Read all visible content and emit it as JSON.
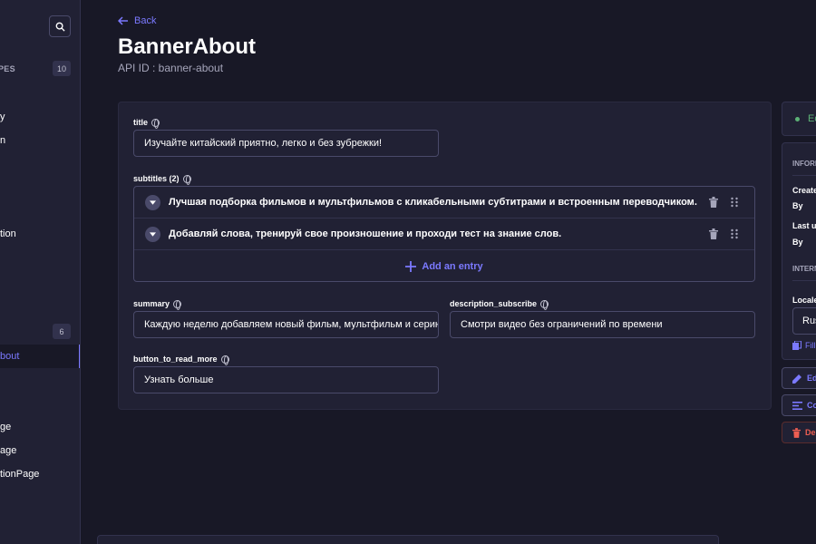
{
  "sidebar": {
    "collection_types_label": "PES",
    "collection_types_count": "10",
    "items_top": [
      "y",
      "n",
      "tion"
    ],
    "single_types_count": "6",
    "active_item": "bout",
    "items_bottom": [
      "ge",
      "age",
      "tionPage"
    ]
  },
  "header": {
    "back_label": "Back",
    "title": "BannerAbout",
    "api_id": "API ID : banner-about"
  },
  "form": {
    "title": {
      "label": "title",
      "value": "Изучайте китайский приятно, легко и без зубрежки!"
    },
    "subtitles": {
      "label": "subtitles (2)",
      "entries": [
        "Лучшая подборка фильмов и мультфильмов с кликабельными субтитрами и встроенным переводчиком.",
        "Добавляй слова, тренируй свое произношение и проходи тест на знание слов."
      ],
      "add_label": "Add an entry"
    },
    "summary": {
      "label": "summary",
      "value": "Каждую неделю добавляем новый фильм, мультфильм и серию!"
    },
    "description_subscribe": {
      "label": "description_subscribe",
      "value": "Смотри видео без ограничений по времени"
    },
    "button_to_read_more": {
      "label": "button_to_read_more",
      "value": "Узнать больше"
    }
  },
  "right_panel": {
    "status": "Ed",
    "info_label": "INFORM",
    "created": "Create",
    "by1": "By",
    "last_updated": "Last up",
    "by2": "By",
    "intern_label": "INTERN",
    "locales_label": "Locales",
    "locale_value": "Rus",
    "fill_label": "Fill",
    "edit_btn": "Ed",
    "config_btn": "Co",
    "delete_btn": "De"
  },
  "colors": {
    "accent": "#7b79ff",
    "danger": "#ee5e52",
    "success": "#5cb176"
  }
}
